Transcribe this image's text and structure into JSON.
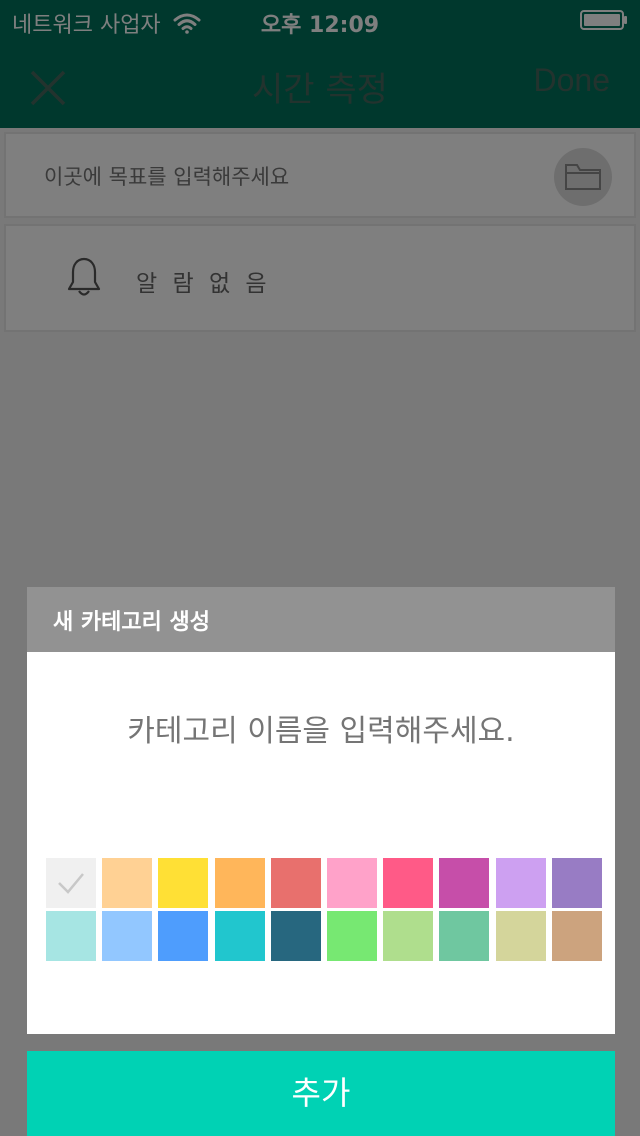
{
  "status_bar": {
    "carrier": "네트워크 사업자",
    "time": "오후 12:09",
    "icons": [
      "wifi-icon",
      "battery-icon"
    ]
  },
  "nav": {
    "title": "시간 측정",
    "done_label": "Done",
    "close_icon": "close-icon"
  },
  "goal": {
    "placeholder": "이곳에 목표를 입력해주세요",
    "folder_icon": "folder-icon"
  },
  "alarm": {
    "label": "알 람 없 음",
    "icon": "bell-icon"
  },
  "dialog": {
    "title": "새 카테고리 생성",
    "input_placeholder": "카테고리 이름을 입력해주세요.",
    "selected_color_index": 0,
    "colors": [
      "#f0f0f0",
      "#ffd194",
      "#ffe035",
      "#ffb65a",
      "#e8706d",
      "#ffa2c9",
      "#ff5a87",
      "#c64ea9",
      "#cda0f1",
      "#987cc4",
      "#a6e5e3",
      "#92c7ff",
      "#4e9dfd",
      "#21c6ce",
      "#27677f",
      "#77e872",
      "#afde8d",
      "#6fc7a0",
      "#d4d59b",
      "#cca37e"
    ]
  },
  "add_button": {
    "label": "추가"
  },
  "theme": {
    "primary": "#00705a",
    "accent": "#00d2b4"
  }
}
